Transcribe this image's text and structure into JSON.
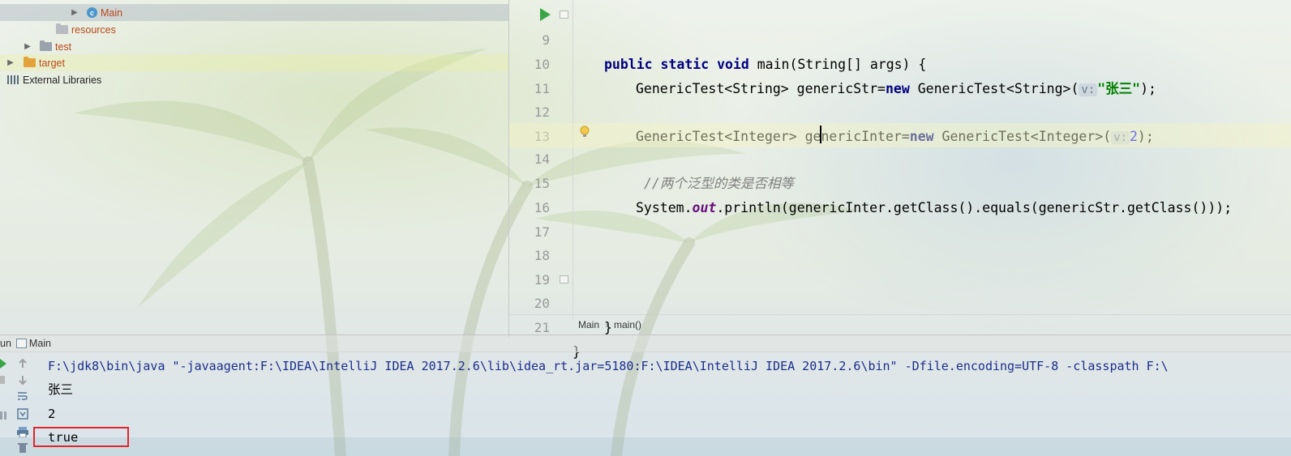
{
  "project_tree": {
    "items": [
      {
        "label": "Main",
        "kind": "class"
      },
      {
        "label": "resources",
        "kind": "folder"
      },
      {
        "label": "test",
        "kind": "folder"
      },
      {
        "label": "target",
        "kind": "folder"
      },
      {
        "label": "External Libraries",
        "kind": "library"
      }
    ]
  },
  "editor": {
    "lines": [
      {
        "num": "9"
      },
      {
        "num": "10"
      },
      {
        "num": "11"
      },
      {
        "num": "12"
      },
      {
        "num": "13"
      },
      {
        "num": "14"
      },
      {
        "num": "15"
      },
      {
        "num": "16"
      },
      {
        "num": "17"
      },
      {
        "num": "18"
      },
      {
        "num": "19"
      },
      {
        "num": "20"
      },
      {
        "num": "21"
      }
    ],
    "line9": {
      "kw": "public static void",
      "rest": " main(String[] args) {"
    },
    "line10": {
      "pre": "GenericTest<String> genericStr=",
      "kw": "new",
      "mid": " GenericTest<String>(",
      "hint": "v:",
      "str": "\"张三\"",
      "end": ");"
    },
    "line12": {
      "pre": "GenericTest<Integer> genericInter=",
      "kw": "new",
      "mid": " GenericTest<Integer>(",
      "hint": "v:",
      "num": "2",
      "end": ");"
    },
    "line14": {
      "comment": "//两个泛型的类是否相等"
    },
    "line15": {
      "pre": "System.",
      "field": "out",
      "rest": ".println(genericInter.getClass().equals(genericStr.getClass()));"
    },
    "line20": {
      "text": "}"
    },
    "line21": {
      "text": "}"
    }
  },
  "breadcrumb": {
    "class": "Main",
    "method": "main()"
  },
  "run_panel": {
    "tab_prefix": "un",
    "tab_label": "Main",
    "output": [
      "F:\\jdk8\\bin\\java \"-javaagent:F:\\IDEA\\IntelliJ IDEA 2017.2.6\\lib\\idea_rt.jar=5180:F:\\IDEA\\IntelliJ IDEA 2017.2.6\\bin\" -Dfile.encoding=UTF-8 -classpath F:\\",
      "张三",
      "2",
      "true"
    ]
  },
  "colors": {
    "keyword": "#000080",
    "string": "#008000",
    "number": "#0000ff",
    "comment": "#808080",
    "field": "#660e7a",
    "run_arrow": "#3aa544",
    "highlight_box": "#e0252b"
  }
}
